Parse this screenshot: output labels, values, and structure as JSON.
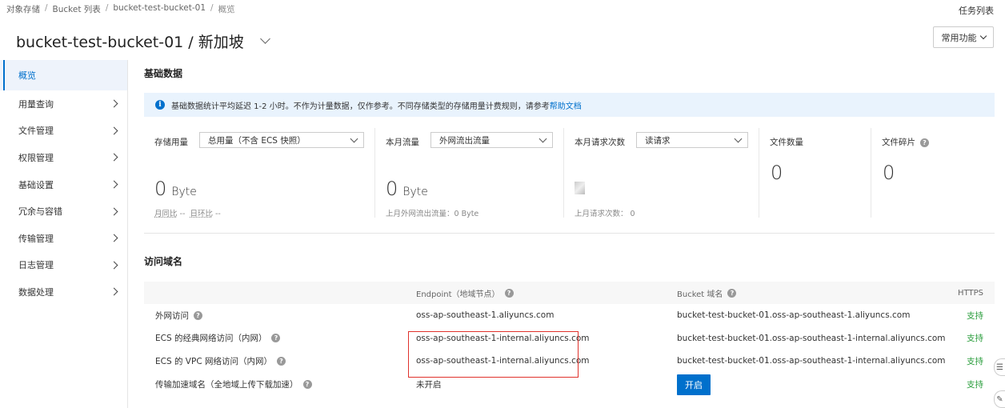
{
  "breadcrumb": [
    "对象存储",
    "Bucket 列表",
    "bucket-test-bucket-01",
    "概览"
  ],
  "header": {
    "task_list": "任务列表",
    "title": "bucket-test-bucket-01 / 新加坡",
    "common_functions": "常用功能"
  },
  "sidebar": {
    "items": [
      {
        "label": "概览",
        "active": true
      },
      {
        "label": "用量查询"
      },
      {
        "label": "文件管理"
      },
      {
        "label": "权限管理"
      },
      {
        "label": "基础设置"
      },
      {
        "label": "冗余与容错"
      },
      {
        "label": "传输管理"
      },
      {
        "label": "日志管理"
      },
      {
        "label": "数据处理"
      }
    ]
  },
  "basic": {
    "title": "基础数据",
    "notice_text": "基础数据统计平均延迟 1-2 小时。不作为计量数据，仅作参考。不同存储类型的存储用量计费规则，请参考",
    "notice_link": "帮助文档",
    "storage": {
      "label": "存储用量",
      "select": "总用量（不含 ECS 快照）",
      "value": "0",
      "unit": "Byte",
      "mom_label": "月同比",
      "mom_value": "--",
      "dod_label": "日环比",
      "dod_value": "--"
    },
    "traffic": {
      "label": "本月流量",
      "select": "外网流出流量",
      "value": "0",
      "unit": "Byte",
      "sub": "上月外网流出流量：0 Byte"
    },
    "requests": {
      "label": "本月请求次数",
      "select": "读请求",
      "sub_label": "上月请求次数：",
      "sub_value": "0"
    },
    "file_count": {
      "label": "文件数量",
      "value": "0"
    },
    "fragments": {
      "label": "文件碎片",
      "value": "0"
    }
  },
  "domains": {
    "title": "访问域名",
    "headers": {
      "endpoint": "Endpoint（地域节点）",
      "bucket_domain": "Bucket 域名",
      "https": "HTTPS"
    },
    "rows": [
      {
        "name": "外网访问",
        "endpoint": "oss-ap-southeast-1.aliyuncs.com",
        "bucket": "bucket-test-bucket-01.oss-ap-southeast-1.aliyuncs.com",
        "https": "支持"
      },
      {
        "name": "ECS 的经典网络访问（内网）",
        "endpoint": "oss-ap-southeast-1-internal.aliyuncs.com",
        "bucket": "bucket-test-bucket-01.oss-ap-southeast-1-internal.aliyuncs.com",
        "https": "支持"
      },
      {
        "name": "ECS 的 VPC 网络访问（内网）",
        "endpoint": "oss-ap-southeast-1-internal.aliyuncs.com",
        "bucket": "bucket-test-bucket-01.oss-ap-southeast-1-internal.aliyuncs.com",
        "https": "支持"
      },
      {
        "name": "传输加速域名（全地域上传下载加速）",
        "endpoint": "未开启",
        "bucket_button": "开启",
        "https": "支持"
      }
    ]
  },
  "colors": {
    "primary": "#0070cc",
    "support": "#2a9d3c",
    "highlight_box": "#e0322c"
  }
}
